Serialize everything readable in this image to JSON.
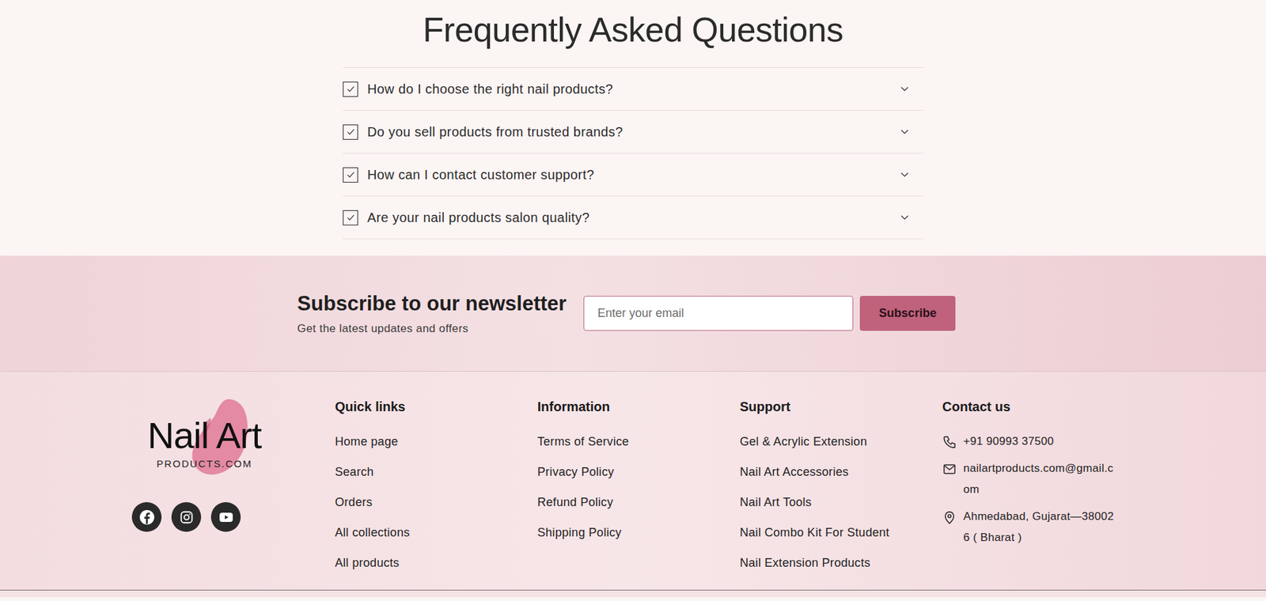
{
  "faq": {
    "title": "Frequently Asked Questions",
    "items": [
      {
        "question": "How do I choose the right nail products?",
        "checked": true,
        "expanded": false
      },
      {
        "question": "Do you sell products from trusted brands?",
        "checked": true,
        "expanded": false
      },
      {
        "question": "How can I contact customer support?",
        "checked": true,
        "expanded": false
      },
      {
        "question": "Are your nail products salon quality?",
        "checked": true,
        "expanded": false
      }
    ]
  },
  "newsletter": {
    "title": "Subscribe to our newsletter",
    "subtitle": "Get the latest updates and offers",
    "email_placeholder": "Enter your email",
    "button": "Subscribe"
  },
  "footer": {
    "logo": {
      "title": "Nail Art",
      "subtitle": "PRODUCTS.COM"
    },
    "columns": [
      {
        "heading": "Quick links",
        "links": [
          "Home page",
          "Search",
          "Orders",
          "All collections",
          "All products"
        ]
      },
      {
        "heading": "Information",
        "links": [
          "Terms of Service",
          "Privacy Policy",
          "Refund Policy",
          "Shipping Policy"
        ]
      },
      {
        "heading": "Support",
        "links": [
          "Gel & Acrylic Extension",
          "Nail Art Accessories",
          "Nail Art Tools",
          "Nail Combo Kit For Student",
          "Nail Extension Products"
        ]
      }
    ],
    "contact": {
      "heading": "Contact us",
      "items": [
        {
          "kind": "phone",
          "text": "+91 90993 37500"
        },
        {
          "kind": "email",
          "text": "nailartproducts.com@gmail.com"
        },
        {
          "kind": "address",
          "text": "Ahmedabad, Gujarat—380026 ( Bharat )"
        }
      ]
    }
  }
}
